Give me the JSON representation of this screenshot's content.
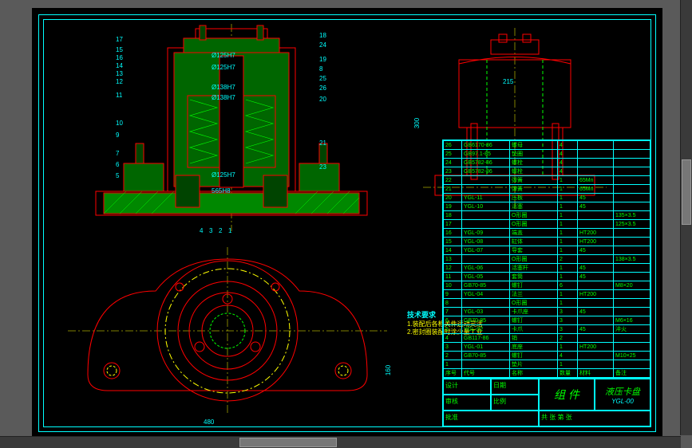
{
  "drawing": {
    "title": "组 件",
    "product_name": "液压卡盘",
    "drawing_no": "YGL-00",
    "notes_heading": "技术要求",
    "notes_line1": "1.装配后各相关件运动灵活",
    "notes_line2": "2.密封圈装配时涂少量工业..."
  },
  "dimensions": {
    "d1": "Ø125H7",
    "d2": "Ø125H7",
    "d3": "Ø138H7",
    "d4": "Ø138H7",
    "d5": "Ø125H7",
    "d6": "565H8",
    "side_w": "215",
    "side_h": "300",
    "plan_w": "480",
    "plan_h": "160"
  },
  "balloons": {
    "b17": "17",
    "b15": "15",
    "b16": "16",
    "b14": "14",
    "b13": "13",
    "b12": "12",
    "b11": "11",
    "b10": "10",
    "b9": "9",
    "b7": "7",
    "b6": "6",
    "b5": "5",
    "b4": "4",
    "b3": "3",
    "b2": "2",
    "b1": "1",
    "b18": "18",
    "b24": "24",
    "b19": "19",
    "b8": "8",
    "b25": "25",
    "b26": "26",
    "b20": "20",
    "b21": "21",
    "b23": "23"
  },
  "parts_list": [
    {
      "no": "26",
      "code": "GB6170-86",
      "name": "螺母",
      "qty": "4",
      "mat": "",
      "note": ""
    },
    {
      "no": "25",
      "code": "GB97.1-85",
      "name": "垫圈",
      "qty": "4",
      "mat": "",
      "note": ""
    },
    {
      "no": "24",
      "code": "GB5782-86",
      "name": "螺栓",
      "qty": "4",
      "mat": "",
      "note": ""
    },
    {
      "no": "23",
      "code": "GB5782-86",
      "name": "螺栓",
      "qty": "4",
      "mat": "",
      "note": ""
    },
    {
      "no": "22",
      "code": "",
      "name": "弹簧",
      "qty": "1",
      "mat": "65Mn",
      "note": ""
    },
    {
      "no": "21",
      "code": "",
      "name": "弹簧",
      "qty": "1",
      "mat": "65Mn",
      "note": ""
    },
    {
      "no": "20",
      "code": "YGL-11",
      "name": "压板",
      "qty": "1",
      "mat": "45",
      "note": ""
    },
    {
      "no": "19",
      "code": "YGL-10",
      "name": "活塞",
      "qty": "1",
      "mat": "45",
      "note": ""
    },
    {
      "no": "18",
      "code": "",
      "name": "O形圈",
      "qty": "1",
      "mat": "",
      "note": "135×3.5"
    },
    {
      "no": "17",
      "code": "",
      "name": "O形圈",
      "qty": "1",
      "mat": "",
      "note": "125×3.5"
    },
    {
      "no": "16",
      "code": "YGL-09",
      "name": "端盖",
      "qty": "1",
      "mat": "HT200",
      "note": ""
    },
    {
      "no": "15",
      "code": "YGL-08",
      "name": "缸体",
      "qty": "1",
      "mat": "HT200",
      "note": ""
    },
    {
      "no": "14",
      "code": "YGL-07",
      "name": "导套",
      "qty": "1",
      "mat": "45",
      "note": ""
    },
    {
      "no": "13",
      "code": "",
      "name": "O形圈",
      "qty": "2",
      "mat": "",
      "note": "138×3.5"
    },
    {
      "no": "12",
      "code": "YGL-06",
      "name": "活塞杆",
      "qty": "1",
      "mat": "45",
      "note": ""
    },
    {
      "no": "11",
      "code": "YGL-05",
      "name": "套筒",
      "qty": "1",
      "mat": "45",
      "note": ""
    },
    {
      "no": "10",
      "code": "GB70-85",
      "name": "螺钉",
      "qty": "6",
      "mat": "",
      "note": "M8×20"
    },
    {
      "no": "9",
      "code": "YGL-04",
      "name": "法兰",
      "qty": "1",
      "mat": "HT200",
      "note": ""
    },
    {
      "no": "8",
      "code": "",
      "name": "O形圈",
      "qty": "1",
      "mat": "",
      "note": ""
    },
    {
      "no": "7",
      "code": "YGL-03",
      "name": "卡爪座",
      "qty": "3",
      "mat": "45",
      "note": ""
    },
    {
      "no": "6",
      "code": "GB70-85",
      "name": "螺钉",
      "qty": "3",
      "mat": "",
      "note": "M6×16"
    },
    {
      "no": "5",
      "code": "YGL-02",
      "name": "卡爪",
      "qty": "3",
      "mat": "45",
      "note": "淬火"
    },
    {
      "no": "4",
      "code": "GB117-86",
      "name": "销",
      "qty": "2",
      "mat": "",
      "note": ""
    },
    {
      "no": "3",
      "code": "YGL-01",
      "name": "底座",
      "qty": "1",
      "mat": "HT200",
      "note": ""
    },
    {
      "no": "2",
      "code": "GB70-85",
      "name": "螺钉",
      "qty": "4",
      "mat": "",
      "note": "M10×25"
    },
    {
      "no": "1",
      "code": "",
      "name": "垫片",
      "qty": "1",
      "mat": "",
      "note": ""
    }
  ],
  "parts_header": {
    "no": "序号",
    "code": "代号",
    "name": "名称",
    "qty": "数量",
    "mat": "材料",
    "note": "备注"
  },
  "titleblock_fields": {
    "design": "设计",
    "check": "审核",
    "appr": "批准",
    "date": "日期",
    "scale": "比例",
    "sheet": "共 张 第 张"
  }
}
